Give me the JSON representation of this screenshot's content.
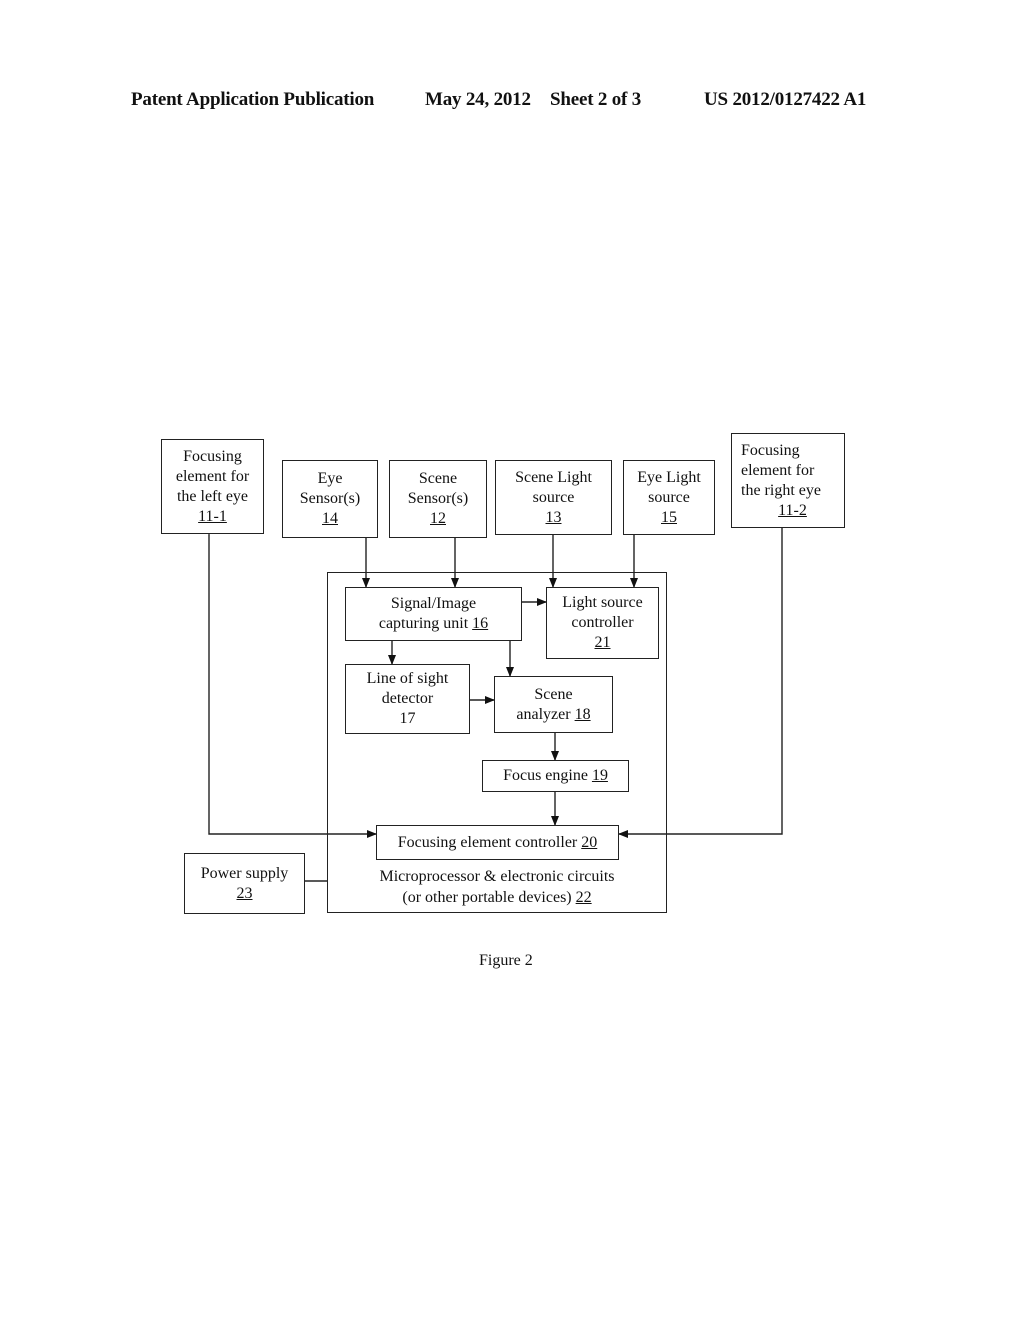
{
  "header": {
    "publication": "Patent Application Publication",
    "date": "May 24, 2012",
    "sheet": "Sheet 2 of 3",
    "number": "US 2012/0127422 A1"
  },
  "blocks": {
    "left_focus": {
      "lines": [
        "Focusing",
        "element for",
        "the left eye"
      ],
      "ref": "11-1"
    },
    "eye_sensor": {
      "lines": [
        "Eye",
        "Sensor(s)"
      ],
      "ref": "14"
    },
    "scene_sensor": {
      "lines": [
        "Scene",
        "Sensor(s)"
      ],
      "ref": "12"
    },
    "scene_light": {
      "lines": [
        "Scene Light",
        "source"
      ],
      "ref": "13"
    },
    "eye_light": {
      "lines": [
        "Eye Light",
        "source"
      ],
      "ref": "15"
    },
    "right_focus": {
      "lines": [
        "Focusing",
        "element for",
        "the right eye"
      ],
      "ref": "11-2"
    },
    "capture_unit": {
      "lines": [
        "Signal/Image"
      ],
      "last": "capturing unit ",
      "ref": "16"
    },
    "light_ctrl": {
      "lines": [
        "Light source",
        "controller"
      ],
      "ref": "21"
    },
    "los_detector": {
      "lines": [
        "Line of sight",
        "detector",
        "17"
      ]
    },
    "scene_analyzer": {
      "lines": [
        "Scene"
      ],
      "last": "analyzer ",
      "ref": "18"
    },
    "focus_engine": {
      "last": "Focus engine ",
      "ref": "19"
    },
    "focus_ctrl": {
      "last": "Focusing element controller ",
      "ref": "20"
    },
    "power": {
      "lines": [
        "Power supply"
      ],
      "ref": "23"
    },
    "micro": {
      "line1": "Microprocessor & electronic circuits",
      "last": "(or other portable devices) ",
      "ref": "22"
    }
  },
  "figure_label": "Figure 2"
}
